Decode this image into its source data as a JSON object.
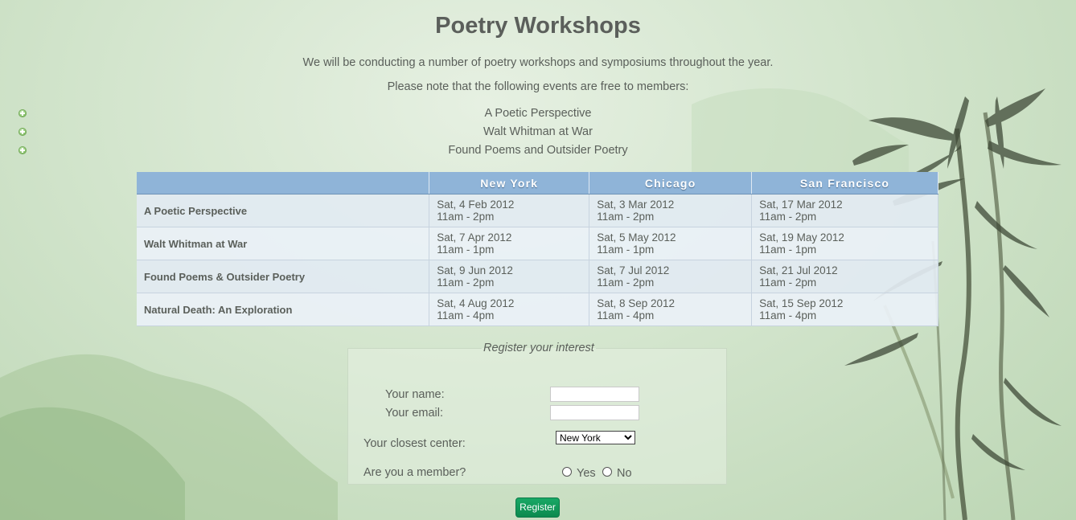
{
  "page": {
    "title": "Poetry Workshops",
    "intro": "We will be conducting a number of poetry workshops and symposiums throughout the year.",
    "note": "Please note that the following events are free to members:",
    "free_events": [
      "A Poetic Perspective",
      "Walt Whitman at War",
      "Found Poems and Outsider Poetry"
    ]
  },
  "schedule": {
    "columns": [
      "",
      "New York",
      "Chicago",
      "San Francisco"
    ],
    "rows": [
      {
        "name": "A Poetic Perspective",
        "slots": [
          [
            "Sat, 4 Feb 2012",
            "11am - 2pm"
          ],
          [
            "Sat, 3 Mar 2012",
            "11am - 2pm"
          ],
          [
            "Sat, 17 Mar 2012",
            "11am - 2pm"
          ]
        ]
      },
      {
        "name": "Walt Whitman at War",
        "slots": [
          [
            "Sat, 7 Apr 2012",
            "11am - 1pm"
          ],
          [
            "Sat, 5 May 2012",
            "11am - 1pm"
          ],
          [
            "Sat, 19 May 2012",
            "11am - 1pm"
          ]
        ]
      },
      {
        "name": "Found Poems & Outsider Poetry",
        "slots": [
          [
            "Sat, 9 Jun 2012",
            "11am - 2pm"
          ],
          [
            "Sat, 7 Jul 2012",
            "11am - 2pm"
          ],
          [
            "Sat, 21 Jul 2012",
            "11am - 2pm"
          ]
        ]
      },
      {
        "name": "Natural Death: An Exploration",
        "slots": [
          [
            "Sat, 4 Aug 2012",
            "11am - 4pm"
          ],
          [
            "Sat, 8 Sep 2012",
            "11am - 4pm"
          ],
          [
            "Sat, 15 Sep 2012",
            "11am - 4pm"
          ]
        ]
      }
    ]
  },
  "form": {
    "legend": "Register your interest",
    "name_label": "Your name:",
    "name_value": "",
    "email_label": "Your email:",
    "email_value": "",
    "center_label": "Your closest center:",
    "center_selected": "New York",
    "member_label": "Are you a member?",
    "member_yes": "Yes",
    "member_no": "No",
    "submit_label": "Register"
  },
  "theme": {
    "background": "#d3e5cd",
    "table_header": "#8fb4d8",
    "button": "#0b8a4f",
    "bullet": "#8cc46f"
  }
}
